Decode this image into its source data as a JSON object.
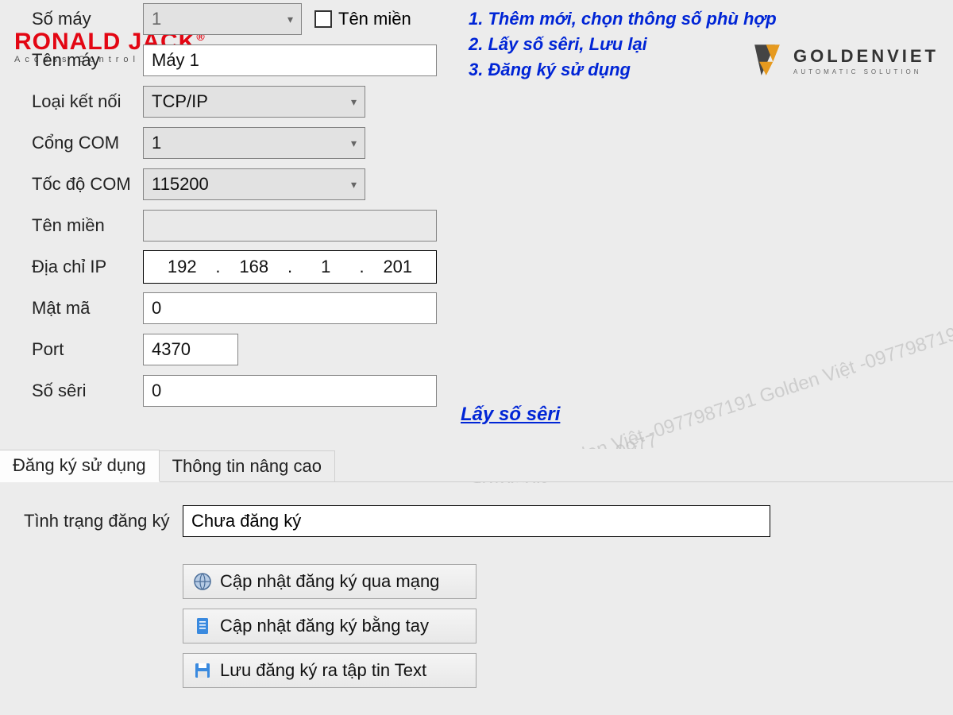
{
  "form": {
    "machine_number_label": "Số máy",
    "machine_number_value": "1",
    "domain_checkbox_label": "Tên miền",
    "machine_name_label": "Tên máy",
    "machine_name_value": "Máy 1",
    "connection_type_label": "Loại kết nối",
    "connection_type_value": "TCP/IP",
    "com_port_label": "Cổng COM",
    "com_port_value": "1",
    "com_speed_label": "Tốc độ COM",
    "com_speed_value": "115200",
    "domain_name_label": "Tên miền",
    "domain_name_value": "",
    "ip_label": "Địa chỉ IP",
    "ip": {
      "a": "192",
      "b": "168",
      "c": "1",
      "d": "201"
    },
    "password_label": "Mật mã",
    "password_value": "0",
    "port_label": "Port",
    "port_value": "4370",
    "serial_label": "Số sêri",
    "serial_value": "0",
    "get_serial_link": "Lấy số sêri"
  },
  "instructions": {
    "line1": "1. Thêm mới, chọn thông số phù hợp",
    "line2": "2. Lấy số sêri, Lưu lại",
    "line3": "3. Đăng ký sử dụng"
  },
  "tabs": {
    "register": "Đăng ký sử dụng",
    "advanced": "Thông tin nâng cao"
  },
  "registration": {
    "status_label": "Tình trạng đăng ký",
    "status_value": "Chưa đăng ký",
    "update_online": "Cập nhật đăng ký qua mạng",
    "update_manual": "Cập nhật đăng ký bằng tay",
    "save_text": "Lưu đăng ký ra tập tin Text"
  },
  "logos": {
    "ronald_main": "RONALD JACK",
    "ronald_sub": "Access Control System",
    "golden_main": "GOLDENVIET",
    "golden_sub": "AUTOMATIC SOLUTION"
  },
  "watermark": "Golden Việt -0977987191 Golden Việt -0977987191 Golden Việt -0977987191 Golden Việt -0977"
}
